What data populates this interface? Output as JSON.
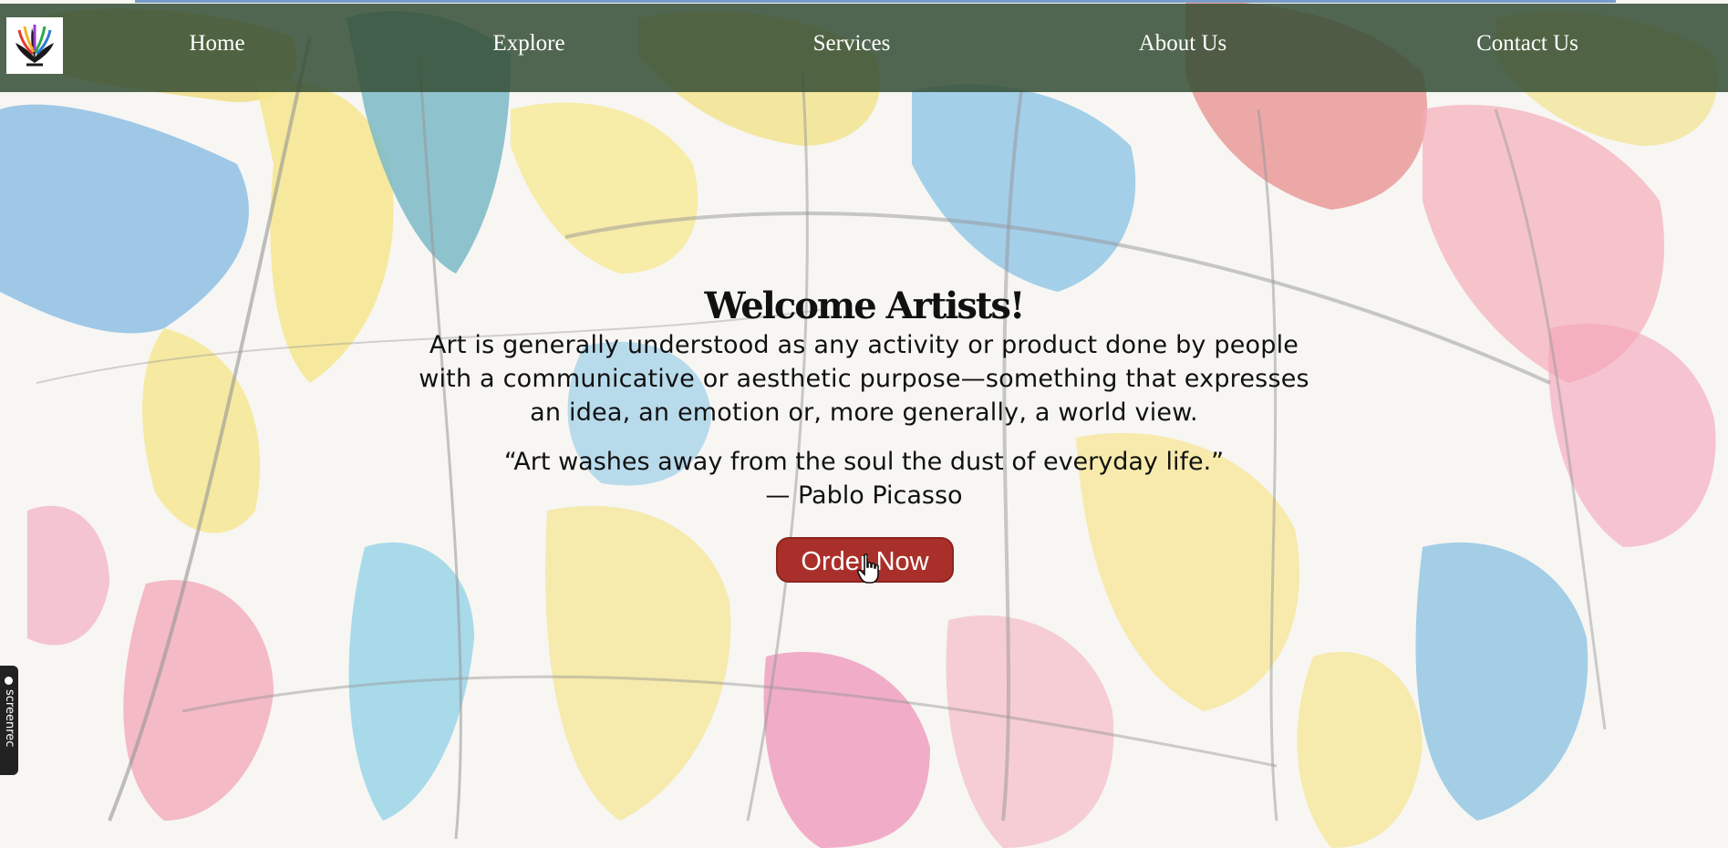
{
  "nav": {
    "logo_icon": "abstract-flower-logo-icon",
    "items": [
      {
        "label": "Home"
      },
      {
        "label": "Explore"
      },
      {
        "label": "Services"
      },
      {
        "label": "About Us"
      },
      {
        "label": "Contact Us"
      }
    ]
  },
  "hero": {
    "title": "Welcome Artists!",
    "description": "Art is generally understood as any activity or product done by people with a communicative or aesthetic purpose—something that expresses an idea, an emotion or, more generally, a world view.",
    "quote": "“Art washes away from the soul the dust of everyday life.”",
    "author": "— Pablo Picasso",
    "cta_label": "Order Now"
  },
  "overlay": {
    "screenrec_label": "screenrec",
    "cursor_icon": "hand-pointer-icon"
  },
  "colors": {
    "navbar": "#344e34",
    "button": "#a9302a",
    "text": "#111111"
  }
}
